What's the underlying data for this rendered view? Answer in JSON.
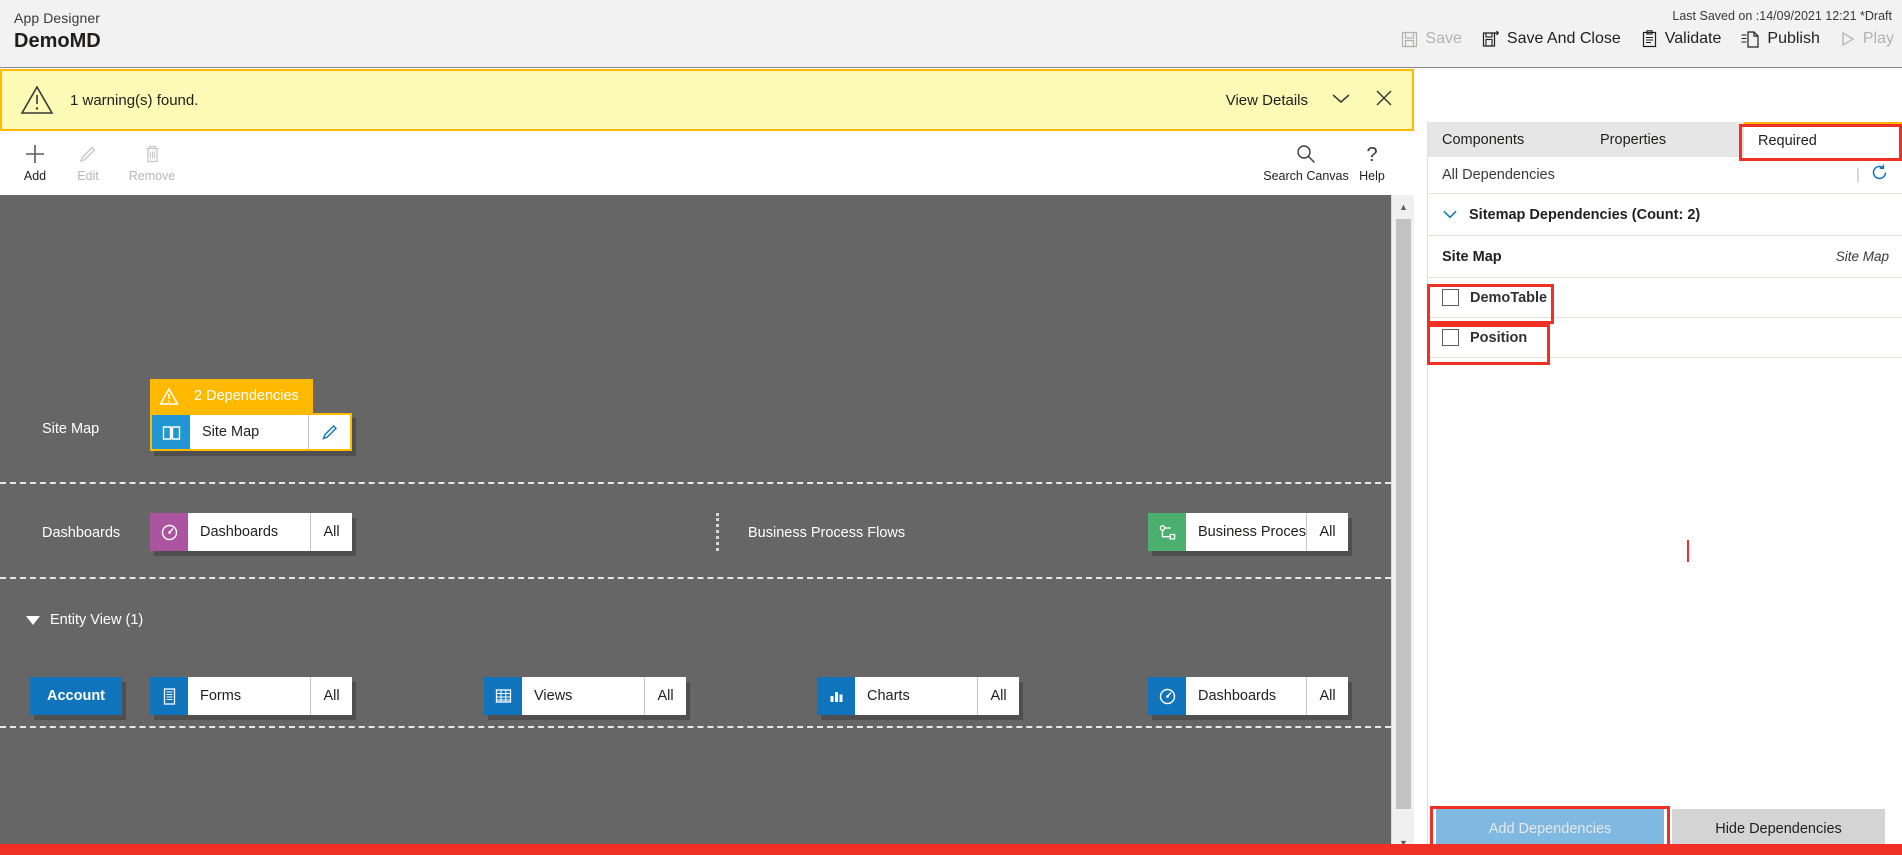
{
  "header": {
    "app_label": "App Designer",
    "app_title": "DemoMD",
    "last_saved": "Last Saved on :14/09/2021 12:21 *Draft",
    "commands": [
      {
        "label": "Save",
        "icon": "save-icon",
        "disabled": true
      },
      {
        "label": "Save And Close",
        "icon": "save-and-close-icon",
        "disabled": false
      },
      {
        "label": "Validate",
        "icon": "validate-clipboard-icon",
        "disabled": false
      },
      {
        "label": "Publish",
        "icon": "publish-icon",
        "disabled": false
      },
      {
        "label": "Play",
        "icon": "play-triangle-icon",
        "disabled": true
      }
    ]
  },
  "warning": {
    "icon": "warning-triangle-icon",
    "message": "1 warning(s) found.",
    "view_details_label": "View Details",
    "chevron_icon": "chevron-down-icon",
    "close_icon": "close-x-icon",
    "border_color": "#ffb900",
    "background_color": "#fcfab4"
  },
  "canvas_toolbar": {
    "buttons": [
      {
        "label": "Add",
        "icon": "plus-icon",
        "disabled": false
      },
      {
        "label": "Edit",
        "icon": "pencil-icon",
        "disabled": true
      },
      {
        "label": "Remove",
        "icon": "trash-icon",
        "disabled": true
      }
    ],
    "right_buttons": [
      {
        "label": "Search Canvas",
        "icon": "search-icon",
        "disabled": false
      },
      {
        "label": "Help",
        "icon": "question-mark-icon",
        "disabled": false
      }
    ]
  },
  "canvas": {
    "background_color": "#666666",
    "sitemap_row": {
      "label": "Site Map",
      "dependency_banner": {
        "text": "2 Dependencies",
        "icon": "warning-triangle-icon",
        "color": "#ffb900"
      },
      "tile": {
        "name": "Site Map",
        "icon": "sitemap-book-icon",
        "icon_color": "#2196d3",
        "edit_icon": "pencil-icon",
        "selected": true
      }
    },
    "dashboards_row": {
      "label": "Dashboards",
      "tile": {
        "name": "Dashboards",
        "badge": "All",
        "icon": "dashboard-gauge-icon",
        "icon_color": "#ab549f"
      }
    },
    "bpf_row": {
      "label": "Business Process Flows",
      "tile": {
        "name": "Business Proces...",
        "badge": "All",
        "icon": "process-flow-icon",
        "icon_color": "#4bb06f"
      }
    },
    "entity_view": {
      "group_label": "Entity View (1)",
      "caret_icon": "caret-down-icon",
      "entity_button": "Account",
      "tiles": [
        {
          "name": "Forms",
          "badge": "All",
          "icon": "forms-icon",
          "icon_color": "#0f74bb"
        },
        {
          "name": "Views",
          "badge": "All",
          "icon": "views-grid-icon",
          "icon_color": "#0f74bb"
        },
        {
          "name": "Charts",
          "badge": "All",
          "icon": "charts-bar-icon",
          "icon_color": "#0f74bb"
        },
        {
          "name": "Dashboards",
          "badge": "All",
          "icon": "dashboard-gauge-icon",
          "icon_color": "#0f74bb"
        }
      ]
    },
    "scrollbar": {
      "up_icon": "scroll-up-arrow-icon",
      "down_icon": "scroll-down-arrow-icon"
    }
  },
  "right_panel": {
    "tabs": [
      {
        "label": "Components",
        "active": false
      },
      {
        "label": "Properties",
        "active": false
      },
      {
        "label": "Required",
        "active": true,
        "highlighted": true
      }
    ],
    "all_dependencies_label": "All Dependencies",
    "refresh_icon": "refresh-circular-arrow-icon",
    "section": {
      "chevron_icon": "chevron-down-icon",
      "label": "Sitemap Dependencies (Count: 2)"
    },
    "group_row": {
      "title": "Site Map",
      "type": "Site Map"
    },
    "items": [
      {
        "label": "DemoTable",
        "checked": false,
        "highlighted": true
      },
      {
        "label": "Position",
        "checked": false,
        "highlighted": true
      }
    ],
    "footer": {
      "add_label": "Add Dependencies",
      "add_disabled": true,
      "add_highlighted": true,
      "hide_label": "Hide Dependencies"
    }
  },
  "annotations": {
    "highlight_color": "#ee3124"
  }
}
